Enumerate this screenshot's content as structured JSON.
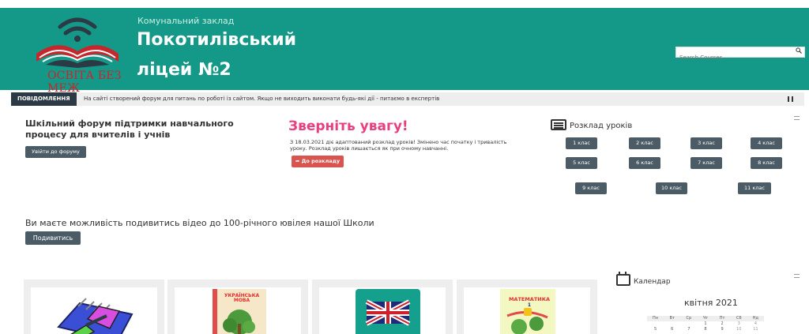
{
  "header": {
    "logo_text": "ОСВІТА БЕЗ МЕЖ",
    "subtitle": "Комунальний заклад",
    "title_line1": "Покотилівський",
    "title_line2": "ліцей №2",
    "search_placeholder": "Search Courses"
  },
  "ticker": {
    "label": "ПОВІДОМЛЕННЯ",
    "text": "На сайті створений форум для питань по роботі із сайтом. Якщо не виходить виконати будь-які дії - питаємо в експертів"
  },
  "forum": {
    "title": "Шкільний форум підтримки навчального процесу для вчителів і учнів",
    "button": "Увійти до форуму"
  },
  "attention": {
    "title": "Зверніть увагу!",
    "text": "З 18.03.2021 діє адаптований розклад уроків! Змінено час початку і тривалість уроку. Розклад  уроків лишається як при очному навчанні.",
    "button": "До розкладу"
  },
  "schedule": {
    "title": "Розклад уроків",
    "classes": [
      "1 клас",
      "2 клас",
      "3 клас",
      "4 клас",
      "5 клас",
      "6 клас",
      "7 клас",
      "8 клас",
      "9 клас",
      "10 клас",
      "11 клас"
    ]
  },
  "video": {
    "text": "Ви маєте можливість подивитись відео до 100-річного ювілея нашої Школи",
    "button": "Подивитись"
  },
  "courses": {
    "ukr_book_title": "УКРАЇНСЬКА МОВА",
    "math_book_title": "МАТЕМАТИКА",
    "math_book_grade": "1"
  },
  "calendar": {
    "title": "Календар",
    "month": "квітня 2021",
    "weekdays": [
      "Пн",
      "Вт",
      "Ср",
      "Чт",
      "Пт",
      "Сб",
      "Нд"
    ],
    "week1": [
      "",
      "",
      "",
      "1",
      "2",
      "3",
      "4"
    ],
    "week2": [
      "5",
      "6",
      "7",
      "8",
      "9",
      "10",
      "11"
    ]
  },
  "colors": {
    "header_bg": "#149887",
    "dark_button": "#4b5c66",
    "attention_pink": "#e8407e",
    "red_button": "#d9534f"
  }
}
